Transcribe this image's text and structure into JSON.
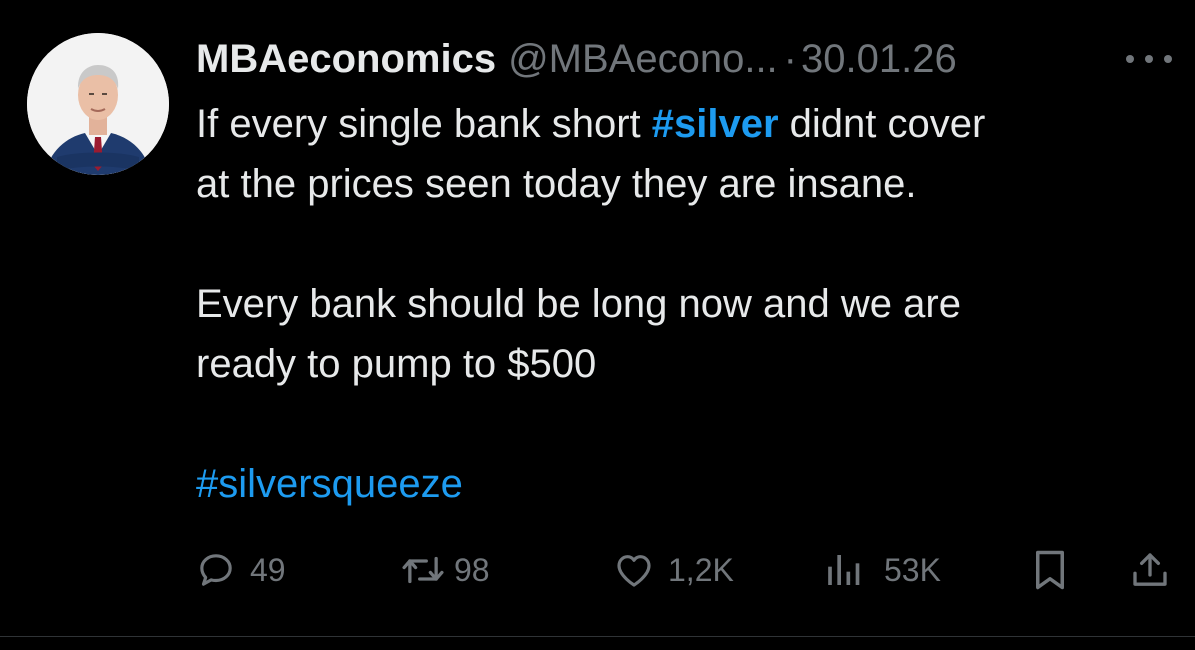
{
  "author": {
    "display_name": "MBAeconomics",
    "handle": "@MBAecono...",
    "separator": "·",
    "date": "30.01.26"
  },
  "tweet": {
    "line1_pre": "If every single bank short ",
    "line1_hashtag": "#silver",
    "line1_post": " didnt cover",
    "line2": "at the prices seen today they are insane.",
    "line3": "Every bank should be long now and we are",
    "line4": "ready to pump to $500",
    "hashtag_line": "#silversqueeze"
  },
  "actions": {
    "replies": "49",
    "reposts": "98",
    "likes": "1,2K",
    "views": "53K"
  },
  "icons": {
    "avatar": "avatar-photo",
    "more": "more-horizontal-icon",
    "reply": "reply-icon",
    "repost": "repost-icon",
    "like": "heart-icon",
    "views": "views-chart-icon",
    "bookmark": "bookmark-icon",
    "share": "share-icon"
  },
  "colors": {
    "background": "#000000",
    "text": "#e7e9ea",
    "muted": "#71767b",
    "link": "#1d9bf0"
  }
}
